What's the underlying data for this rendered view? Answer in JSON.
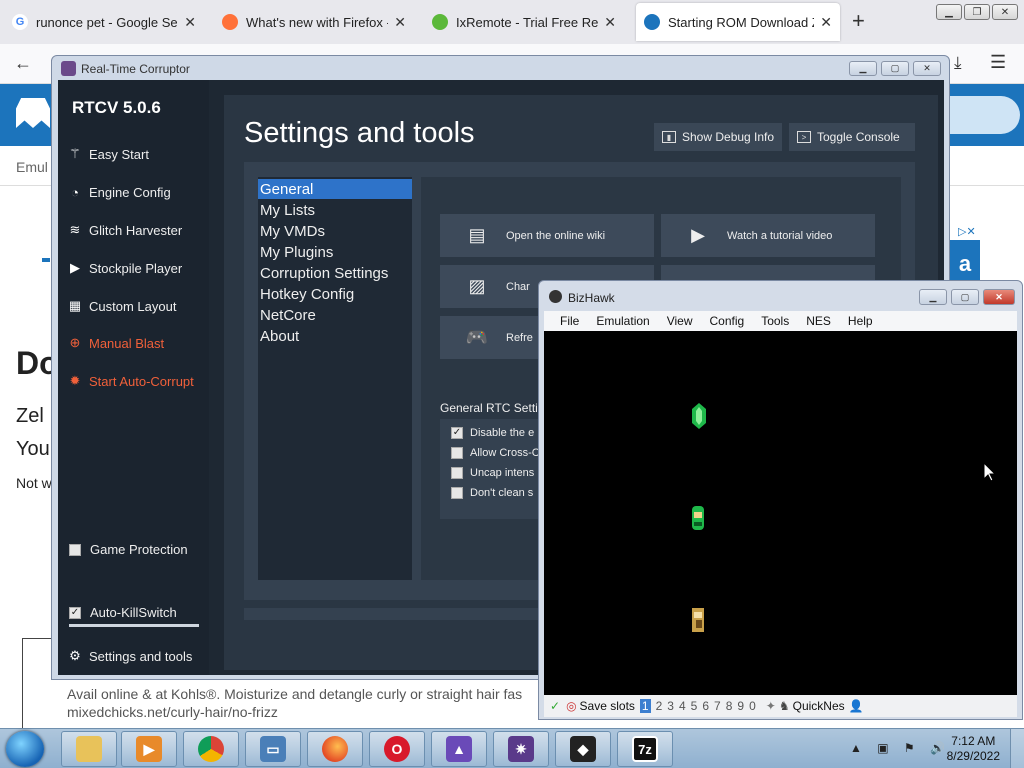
{
  "browser": {
    "tabs": [
      {
        "title": "runonce pet - Google Search",
        "favicon": "G",
        "color": "#4285f4"
      },
      {
        "title": "What's new with Firefox - Mo",
        "favicon": "",
        "color": "#ff7139"
      },
      {
        "title": "IxRemote - Trial Free Remote",
        "favicon": "",
        "color": "#5bb83a"
      },
      {
        "title": "Starting ROM Download Zelda",
        "favicon": "",
        "color": "#1c74bc"
      }
    ],
    "new_tab": "+",
    "close_glyph": "✕"
  },
  "webpage": {
    "heading": "Do",
    "line1": "Zel",
    "line2": "You",
    "line3": "Not w",
    "ad_text": "Avail online & at Kohls®. Moisturize and detangle curly or straight hair fas",
    "ad_url": "mixedchicks.net/curly-hair/no-frizz",
    "ad_letter": "a"
  },
  "rtcv": {
    "window_title": "Real-Time Corruptor",
    "version": "RTCV 5.0.6",
    "sidebar": [
      {
        "label": "Easy Start",
        "icon": "wand-icon",
        "glyph": "⚚"
      },
      {
        "label": "Engine Config",
        "icon": "gauge-icon",
        "glyph": "◔"
      },
      {
        "label": "Glitch Harvester",
        "icon": "layers-icon",
        "glyph": "≋"
      },
      {
        "label": "Stockpile Player",
        "icon": "play-icon",
        "glyph": "▶"
      },
      {
        "label": "Custom Layout",
        "icon": "grid-icon",
        "glyph": "▦"
      },
      {
        "label": "Manual Blast",
        "icon": "crosshair-icon",
        "glyph": "⊕"
      },
      {
        "label": "Start Auto-Corrupt",
        "icon": "flame-icon",
        "glyph": "✹"
      }
    ],
    "game_protection": "Game Protection",
    "auto_killswitch": "Auto-KillSwitch",
    "settings_tools": "Settings and tools",
    "heading": "Settings and tools",
    "show_debug": "Show Debug Info",
    "toggle_console": "Toggle Console",
    "menu": [
      "General",
      "My Lists",
      "My VMDs",
      "My Plugins",
      "Corruption Settings",
      "Hotkey Config",
      "NetCore",
      "About"
    ],
    "tiles": [
      {
        "label": "Open the online wiki",
        "glyph": "▤"
      },
      {
        "label": "Watch a tutorial video",
        "glyph": "▶"
      },
      {
        "label": "Char",
        "glyph": "▨"
      },
      {
        "label": "",
        "glyph": "▲"
      },
      {
        "label": "Refre",
        "glyph": "🎮"
      }
    ],
    "general_label": "General RTC Settin",
    "options": [
      {
        "label": "Disable the e",
        "checked": true
      },
      {
        "label": "Allow Cross-C",
        "checked": false
      },
      {
        "label": "Uncap intens",
        "checked": false
      },
      {
        "label": "Don't clean s",
        "checked": false
      }
    ]
  },
  "bizhawk": {
    "title": "BizHawk",
    "menu": [
      "File",
      "Emulation",
      "View",
      "Config",
      "Tools",
      "NES",
      "Help"
    ],
    "status": {
      "save_slots": "Save slots",
      "slots": [
        "1",
        "2",
        "3",
        "4",
        "5",
        "6",
        "7",
        "8",
        "9",
        "0"
      ],
      "core": "QuickNes"
    }
  },
  "taskbar": {
    "time": "7:12 AM",
    "date": "8/29/2022",
    "app_7z": "7z"
  }
}
